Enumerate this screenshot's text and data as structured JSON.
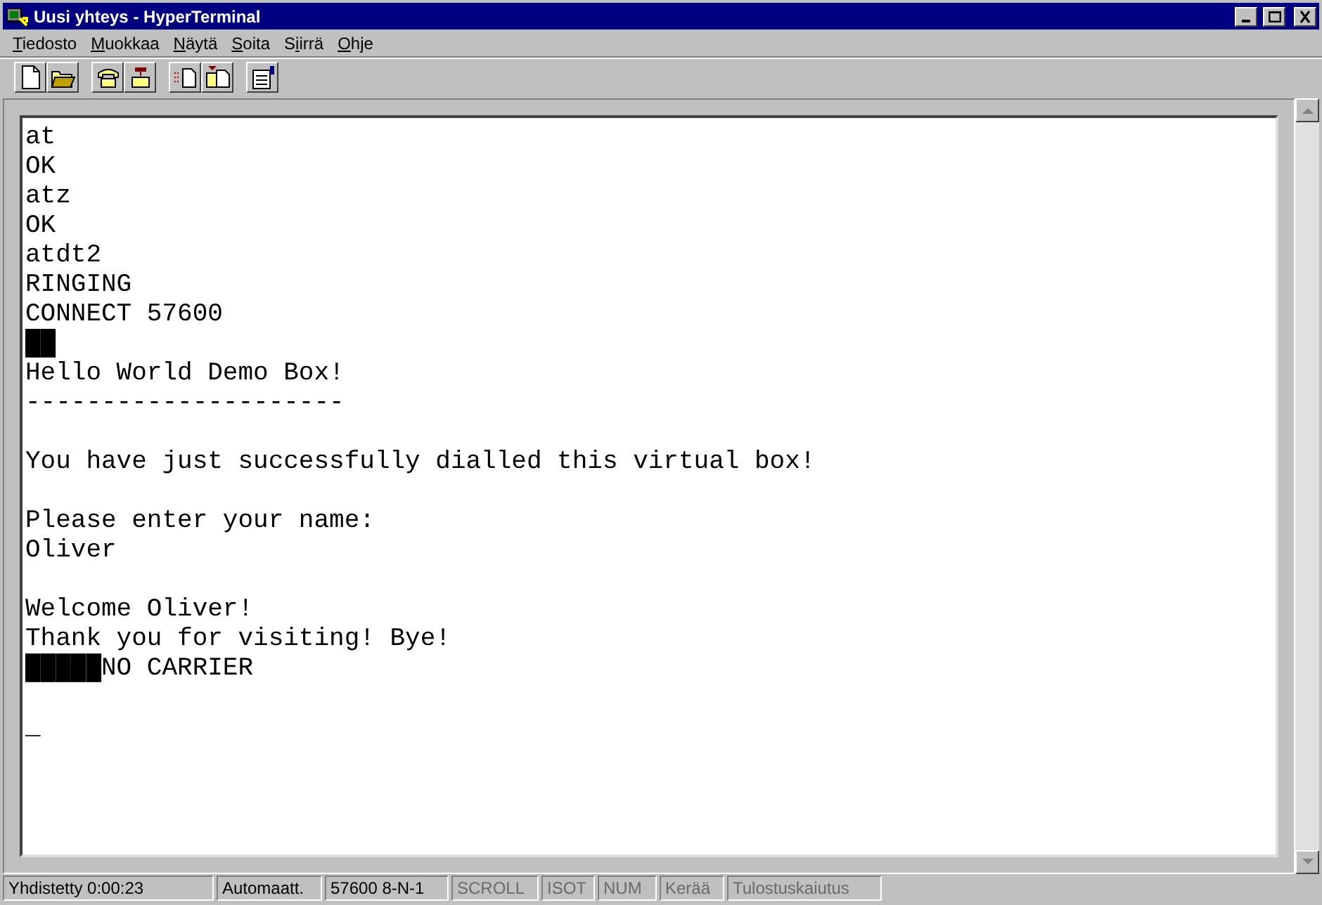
{
  "window": {
    "title": "Uusi yhteys - HyperTerminal"
  },
  "menu": [
    {
      "underlined": "T",
      "after": "iedosto"
    },
    {
      "underlined": "M",
      "after": "uokkaa"
    },
    {
      "underlined": "N",
      "after": "äytä"
    },
    {
      "underlined": "S",
      "after": "oita"
    },
    {
      "before": "S",
      "underlined": "i",
      "after": "irrä"
    },
    {
      "underlined": "O",
      "after": "hje"
    }
  ],
  "toolbar": [
    [
      {
        "kind": "new"
      },
      {
        "kind": "open"
      }
    ],
    [
      {
        "kind": "call"
      },
      {
        "kind": "hangup"
      }
    ],
    [
      {
        "kind": "send"
      },
      {
        "kind": "receive"
      }
    ],
    [
      {
        "kind": "properties"
      }
    ]
  ],
  "terminal": {
    "paragraphs": [
      [
        "at",
        "OK",
        "atz",
        "OK",
        "atdt2",
        "RINGING",
        "CONNECT 57600",
        "██",
        "Hello World Demo Box!",
        "---------------------"
      ],
      [
        "You have just successfully dialled this virtual box!"
      ],
      [
        "Please enter your name:",
        "Oliver"
      ],
      [
        "Welcome Oliver!",
        "Thank you for visiting! Bye!",
        "█████NO CARRIER"
      ],
      [
        "_"
      ]
    ]
  },
  "status_bar": [
    {
      "text": "Yhdistetty 0:00:23",
      "disabled": false
    },
    {
      "text": "Automaatt.",
      "disabled": false
    },
    {
      "text": "57600 8-N-1",
      "disabled": false
    },
    {
      "text": "SCROLL",
      "disabled": true
    },
    {
      "text": "ISOT",
      "disabled": true
    },
    {
      "text": "NUM",
      "disabled": true
    },
    {
      "text": "Kerää",
      "disabled": true
    },
    {
      "text": "Tulostuskaiutus",
      "disabled": true
    }
  ]
}
